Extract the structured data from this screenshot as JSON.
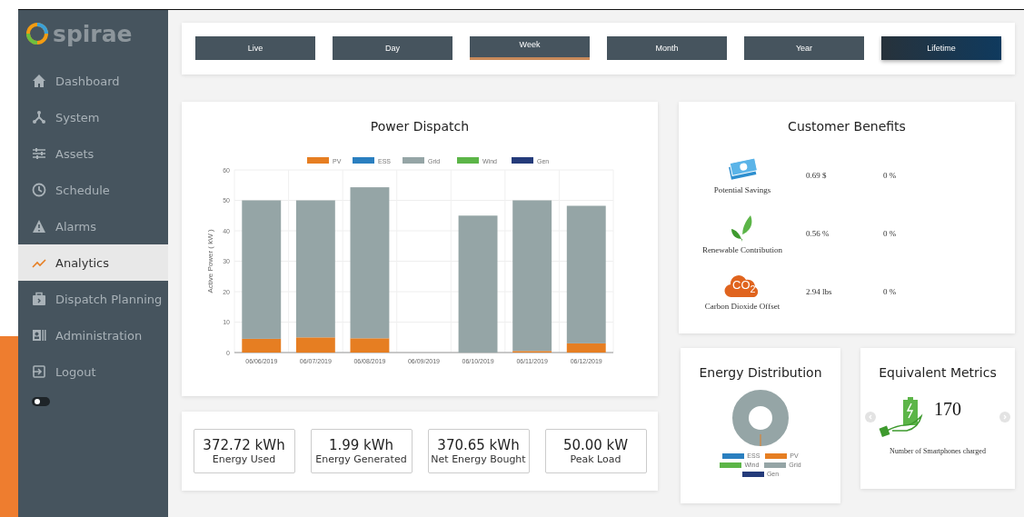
{
  "sidebar": {
    "logo": "spirae",
    "items": [
      {
        "label": "Dashboard",
        "selected": false
      },
      {
        "label": "System",
        "selected": false
      },
      {
        "label": "Assets",
        "selected": false
      },
      {
        "label": "Schedule",
        "selected": false
      },
      {
        "label": "Alarms",
        "selected": false
      },
      {
        "label": "Analytics",
        "selected": true
      },
      {
        "label": "Dispatch Planning",
        "selected": false
      },
      {
        "label": "Administration",
        "selected": false
      },
      {
        "label": "Logout",
        "selected": false
      }
    ],
    "toggle": {
      "on": false
    }
  },
  "tabs": [
    {
      "label": "Live",
      "selected": false,
      "hovered": false
    },
    {
      "label": "Day",
      "selected": false,
      "hovered": false
    },
    {
      "label": "Week",
      "selected": true,
      "hovered": false
    },
    {
      "label": "Month",
      "selected": false,
      "hovered": false
    },
    {
      "label": "Year",
      "selected": false,
      "hovered": false
    },
    {
      "label": "Lifetime",
      "selected": false,
      "hovered": true
    }
  ],
  "power_dispatch": {
    "chart_data": {
      "type": "bar",
      "title": "Power Dispatch",
      "ylabel": "Active Power ( kW )",
      "stacked": true,
      "grid": true,
      "legend": "top",
      "categories": [
        "06/06/2019",
        "06/07/2019",
        "06/08/2019",
        "06/09/2019",
        "06/10/2019",
        "06/11/2019",
        "06/12/2019"
      ],
      "ylim": [
        0,
        60
      ],
      "yticks": [
        0,
        10,
        20,
        30,
        40,
        50,
        60
      ],
      "series": [
        {
          "name": "PV",
          "color": "#e67e22",
          "values": [
            4.5,
            5,
            4.7,
            0,
            null,
            0.5,
            3
          ]
        },
        {
          "name": "ESS",
          "color": "#2a7fc0",
          "values": [
            0,
            0,
            0,
            0,
            0,
            0,
            0
          ]
        },
        {
          "name": "Grid",
          "color": "#95a5a6",
          "values": [
            45.5,
            45,
            49.6,
            0,
            45,
            49.5,
            45.2
          ]
        },
        {
          "name": "Wind",
          "color": "#5cb548",
          "values": [
            0,
            0,
            0,
            0,
            0,
            0,
            0
          ]
        },
        {
          "name": "Gen",
          "color": "#243b7a",
          "values": [
            0,
            0,
            0,
            0,
            0,
            0,
            0
          ]
        }
      ]
    }
  },
  "stats": [
    {
      "value": "372.72 kWh",
      "label": "Energy Used"
    },
    {
      "value": "1.99 kWh",
      "label": "Energy Generated"
    },
    {
      "value": "370.65 kWh",
      "label": "Net Energy Bought"
    },
    {
      "value": "50.00 kW",
      "label": "Peak Load"
    }
  ],
  "customer_benefits": {
    "title": "Customer Benefits",
    "rows": [
      {
        "kind": "money",
        "label": "Potential Savings",
        "value": "0.69 $",
        "change": "0 %"
      },
      {
        "kind": "leaf",
        "label": "Renewable Contribution",
        "value": "0.56 %",
        "change": "0 %"
      },
      {
        "kind": "co2",
        "icon_text": "CO$_{2}$",
        "label": "Carbon Dioxide Offset",
        "value": "2.94 lbs",
        "change": "0 %"
      }
    ]
  },
  "energy_distribution": {
    "title": "Energy Distribution",
    "legend": [
      {
        "label": "ESS",
        "color": "#2a7fc0"
      },
      {
        "label": "PV",
        "color": "#e67e22"
      },
      {
        "label": "Wind",
        "color": "#5cb548"
      },
      {
        "label": "Grid",
        "color": "#95a5a6"
      },
      {
        "label": "Gen",
        "color": "#243b7a"
      }
    ]
  },
  "equivalent_metrics": {
    "title": "Equivalent Metrics",
    "value": "170",
    "caption": "Number of Smartphones charged"
  }
}
